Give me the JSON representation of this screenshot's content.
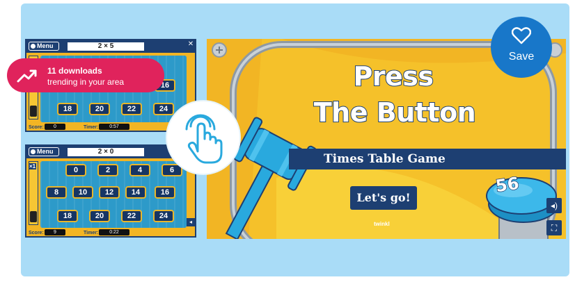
{
  "trending": {
    "count_label": "11 downloads",
    "sub_label": "trending in your area",
    "icon": "trending-up-icon"
  },
  "save": {
    "label": "Save",
    "icon": "heart-outline-icon"
  },
  "panel1": {
    "menu_label": "Menu",
    "question": "2 × 5",
    "numbers": [
      "16",
      "18",
      "20",
      "22",
      "24"
    ],
    "score_label": "Score:",
    "score_value": "0",
    "timer_label": "Timer:",
    "timer_value": "0:57"
  },
  "panel2": {
    "menu_label": "Menu",
    "question": "2 × 0",
    "multiplier": "×1",
    "numbers": [
      "0",
      "2",
      "4",
      "6",
      "8",
      "10",
      "12",
      "14",
      "16",
      "18",
      "20",
      "22",
      "24"
    ],
    "score_label": "Score:",
    "score_value": "9",
    "timer_label": "Timer:",
    "timer_value": "0:22"
  },
  "slide": {
    "title_line1": "Press",
    "title_line2": "The Button",
    "subtitle": "Times Table Game",
    "start_label": "Let's go!",
    "button_number": "56",
    "brand": "twinkl"
  },
  "colors": {
    "navy": "#1d3f72",
    "yellow": "#f2b524",
    "cyan": "#29a9de",
    "pink": "#e0235c",
    "save_blue": "#1877c9",
    "card_bg": "#a9dcf7"
  }
}
